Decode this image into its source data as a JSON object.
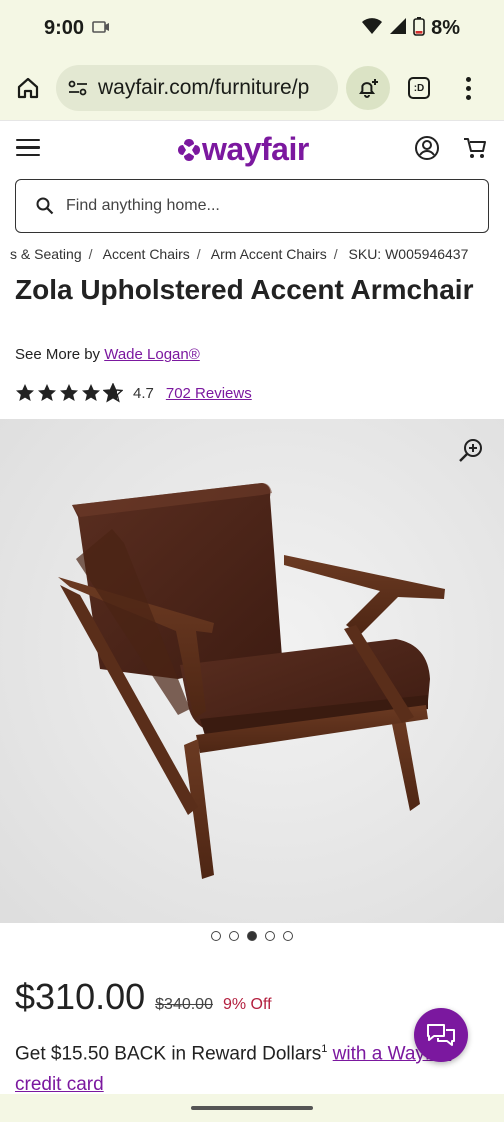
{
  "status_bar": {
    "time": "9:00",
    "battery": "8%"
  },
  "browser": {
    "url": "wayfair.com/furniture/p"
  },
  "site": {
    "logo": "wayfair",
    "search_placeholder": "Find anything home..."
  },
  "breadcrumb": [
    "s & Seating",
    "Accent Chairs",
    "Arm Accent Chairs",
    "SKU: W005946437"
  ],
  "product": {
    "title": "Zola Upholstered Accent Armchair",
    "see_more_prefix": "See More by",
    "brand": "Wade Logan®",
    "rating": "4.7",
    "rating_stars": 4.7,
    "reviews": "702 Reviews",
    "image_count": 5,
    "active_image": 3,
    "price": "$310.00",
    "original_price": "$340.00",
    "discount": "9% Off"
  },
  "reward": {
    "text": "Get $15.50 BACK in Reward Dollars",
    "footnote": "1",
    "link": "with a Wayfair credit card"
  },
  "colors": {
    "brand": "#7b189f",
    "discount": "#b31f3e",
    "chrome": "#f4f7e4"
  }
}
